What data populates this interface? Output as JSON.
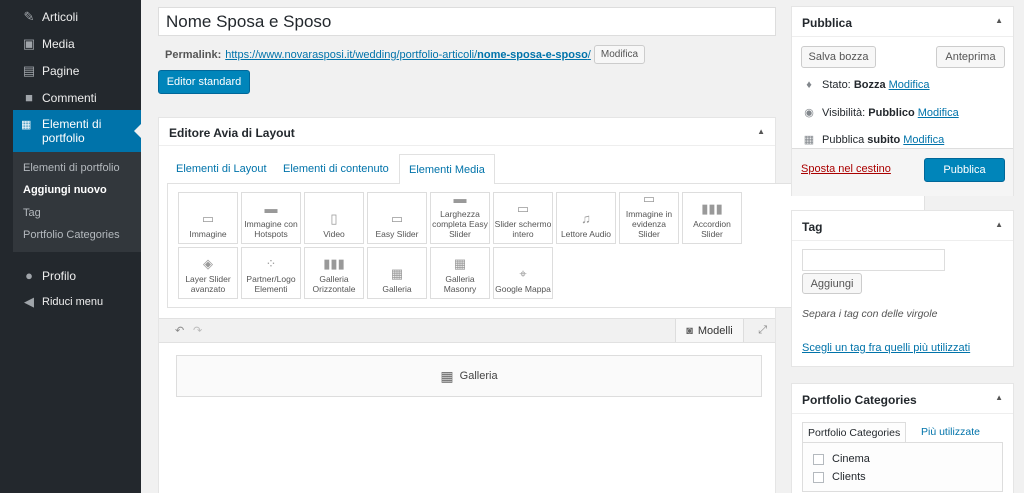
{
  "sidebar": {
    "items": [
      {
        "label": "Articoli",
        "icon": "pin-icon"
      },
      {
        "label": "Media",
        "icon": "media-icon"
      },
      {
        "label": "Pagine",
        "icon": "page-icon"
      },
      {
        "label": "Commenti",
        "icon": "comment-icon"
      }
    ],
    "active": {
      "label": "Elementi di portfolio",
      "icon": "portfolio-icon"
    },
    "submenu": [
      "Elementi di portfolio",
      "Aggiungi nuovo",
      "Tag",
      "Portfolio Categories"
    ],
    "current_submenu": "Aggiungi nuovo",
    "profile": "Profilo",
    "collapse": "Riduci menu"
  },
  "editor": {
    "title": "Nome Sposa e Sposo",
    "permalink_label": "Permalink:",
    "permalink_base": "https://www.novarasposi.it/wedding/portfolio-articoli/",
    "permalink_slug": "nome-sposa-e-sposo",
    "permalink_trail": "/",
    "permalink_edit": "Modifica",
    "standard_editor": "Editor standard"
  },
  "builder": {
    "title": "Editore Avia di Layout",
    "tabs": [
      "Elementi di Layout",
      "Elementi di contenuto",
      "Elementi Media"
    ],
    "active_tab": "Elementi Media",
    "elements_row1": [
      "Immagine",
      "Immagine con Hotspots",
      "Video",
      "Easy Slider",
      "Larghezza completa Easy Slider",
      "Slider schermo intero",
      "Lettore Audio",
      "Immagine in evidenza Slider",
      "Accordion Slider"
    ],
    "elements_row2": [
      "Layer Slider avanzato",
      "Partner/Logo Elementi",
      "Galleria Orizzontale",
      "Galleria",
      "Galleria Masonry",
      "Google Mappa"
    ],
    "templates": "Modelli",
    "canvas_element": "Galleria"
  },
  "publish": {
    "title": "Pubblica",
    "save_draft": "Salva bozza",
    "preview": "Anteprima",
    "status_label": "Stato:",
    "status_value": "Bozza",
    "visibility_label": "Visibilità:",
    "visibility_value": "Pubblico",
    "schedule_label": "Pubblica",
    "schedule_value": "subito",
    "edit": "Modifica",
    "trash": "Sposta nel cestino",
    "publish_button": "Pubblica"
  },
  "tags": {
    "title": "Tag",
    "input_value": "",
    "add_button": "Aggiungi",
    "hint": "Separa i tag con delle virgole",
    "choose_link": "Scegli un tag fra quelli più utilizzati"
  },
  "categories": {
    "title": "Portfolio Categories",
    "tab_all": "Portfolio Categories",
    "tab_popular": "Più utilizzate",
    "items": [
      "Cinema",
      "Clients"
    ]
  },
  "colors": {
    "accent": "#0073aa",
    "primary_button": "#0085ba",
    "sidebar_bg": "#23282d",
    "danger": "#a00"
  }
}
